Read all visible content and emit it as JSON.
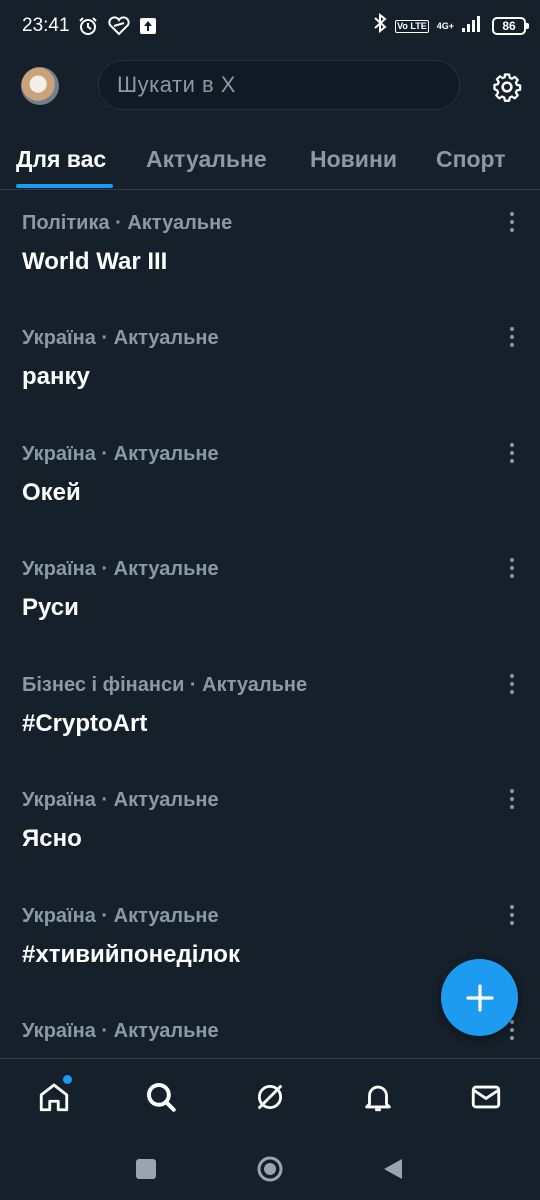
{
  "status_bar": {
    "time": "23:41",
    "volte_badge": "Vo LTE",
    "network": "4G+",
    "battery": "86"
  },
  "header": {
    "avatar_icon": "profile-avatar",
    "search_placeholder": "Шукати в X",
    "settings_icon": "gear-icon"
  },
  "tabs": [
    {
      "label": "Для вас",
      "active": true
    },
    {
      "label": "Актуальне",
      "active": false
    },
    {
      "label": "Новини",
      "active": false
    },
    {
      "label": "Спорт",
      "active": false
    }
  ],
  "trends": [
    {
      "category": "Політика · Актуальне",
      "title": "World War III"
    },
    {
      "category": "Україна · Актуальне",
      "title": "ранку"
    },
    {
      "category": "Україна · Актуальне",
      "title": "Окей"
    },
    {
      "category": "Україна · Актуальне",
      "title": "Руси"
    },
    {
      "category": "Бізнес і фінанси · Актуальне",
      "title": "#CryptoArt"
    },
    {
      "category": "Україна · Актуальне",
      "title": "Ясно"
    },
    {
      "category": "Україна · Актуальне",
      "title": "#хтивийпонеділок"
    },
    {
      "category": "Україна · Актуальне",
      "title": ""
    }
  ],
  "bottom_nav": [
    "home-icon",
    "search-icon",
    "grok-icon",
    "bell-icon",
    "mail-icon"
  ],
  "colors": {
    "background": "#15202b",
    "accent": "#1d9bf0",
    "muted_text": "#8b98a5",
    "divider": "#2f3b47"
  }
}
